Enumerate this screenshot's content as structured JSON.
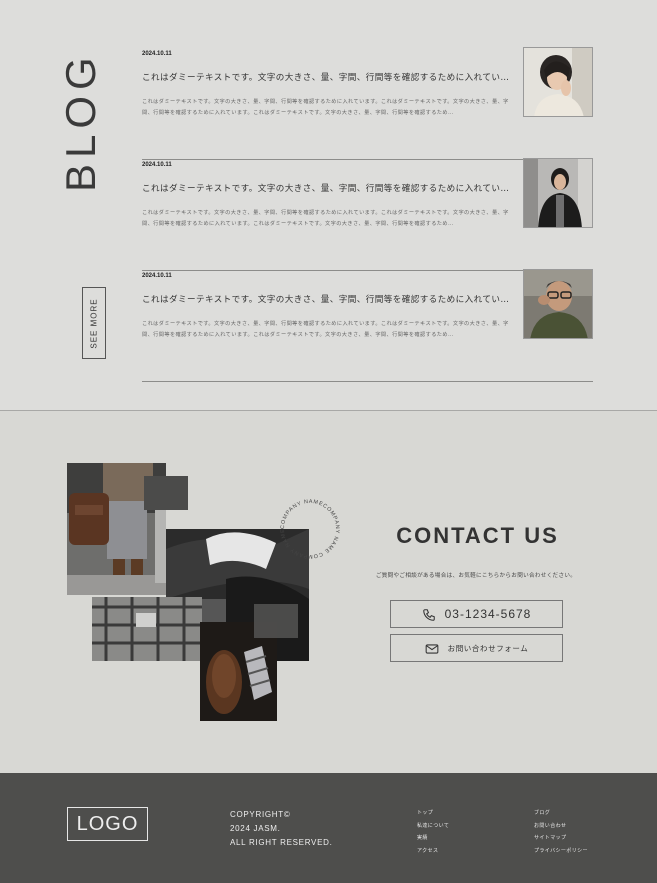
{
  "blog": {
    "heading": "BLOG",
    "see_more": "SEE MORE",
    "posts": [
      {
        "date": "2024.10.11",
        "title": "これはダミーテキストです。文字の大きさ、量、字間、行間等を確認するために入れてい…",
        "excerpt": "これはダミーテキストです。文字の大きさ、量、字間、行間等を確認するために入れています。これはダミーテキストです。文字の大きさ、量、字間、行間等を確認するために入れています。これはダミーテキストです。文字の大きさ、量、字間、行間等を確認するため…",
        "thumb": "portrait-man-long-hair"
      },
      {
        "date": "2024.10.11",
        "title": "これはダミーテキストです。文字の大きさ、量、字間、行間等を確認するために入れてい…",
        "excerpt": "これはダミーテキストです。文字の大きさ、量、字間、行間等を確認するために入れています。これはダミーテキストです。文字の大きさ、量、字間、行間等を確認するために入れています。これはダミーテキストです。文字の大きさ、量、字間、行間等を確認するため…",
        "thumb": "portrait-man-street"
      },
      {
        "date": "2024.10.11",
        "title": "これはダミーテキストです。文字の大きさ、量、字間、行間等を確認するために入れてい…",
        "excerpt": "これはダミーテキストです。文字の大きさ、量、字間、行間等を確認するために入れています。これはダミーテキストです。文字の大きさ、量、字間、行間等を確認するために入れています。これはダミーテキストです。文字の大きさ、量、字間、行間等を確認するため…",
        "thumb": "portrait-man-glasses"
      }
    ]
  },
  "contact": {
    "heading": "CONTACT US",
    "description": "ご質問やご相談がある場合は、お気軽にこちらからお問い合わせください。",
    "circle_text": "COMPANY NAMECOMPANY NAME COMPANY NAME",
    "phone": "03-1234-5678",
    "form_label": "お問い合わせフォーム",
    "phone_icon": "phone-icon",
    "mail_icon": "mail-icon"
  },
  "footer": {
    "logo": "LOGO",
    "copyright_lines": [
      "COPYRIGHT©",
      "2024 JASM.",
      "ALL RIGHT RESERVED."
    ],
    "links_col1": [
      "トップ",
      "私達について",
      "実績",
      "アクセス"
    ],
    "links_col2": [
      "ブログ",
      "お問い合わせ",
      "サイトマップ",
      "プライバシーポリシー"
    ]
  },
  "colors": {
    "background": "#dcdcd8",
    "footer": "#4e4e4c",
    "text": "#333333"
  }
}
